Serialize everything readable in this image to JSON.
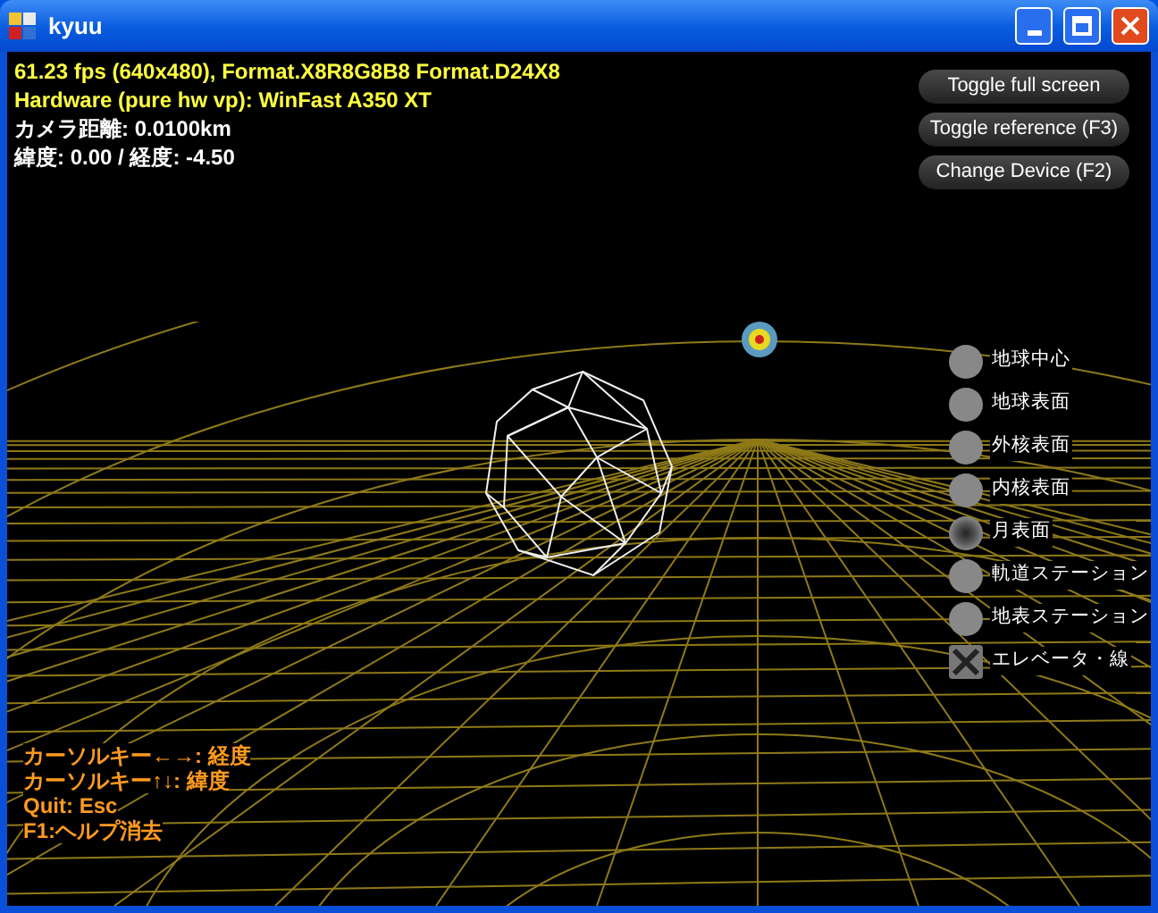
{
  "window": {
    "title": "kyuu"
  },
  "info_lines": [
    {
      "text": "61.23 fps (640x480), Format.X8R8G8B8 Format.D24X8",
      "kind": "stat"
    },
    {
      "text": "Hardware (pure hw vp): WinFast A350 XT",
      "kind": "stat"
    },
    {
      "text": "カメラ距離: 0.0100km",
      "kind": "value"
    },
    {
      "text": "緯度:  0.00 / 経度:  -4.50",
      "kind": "value"
    }
  ],
  "buttons": [
    "Toggle full screen",
    "Toggle reference (F3)",
    "Change Device (F2)"
  ],
  "options": [
    {
      "label": "地球中心",
      "kind": "radio",
      "selected": false
    },
    {
      "label": "地球表面",
      "kind": "radio",
      "selected": false
    },
    {
      "label": "外核表面",
      "kind": "radio",
      "selected": false
    },
    {
      "label": "内核表面",
      "kind": "radio",
      "selected": false
    },
    {
      "label": "月表面",
      "kind": "radio",
      "selected": true
    },
    {
      "label": "軌道ステーション",
      "kind": "radio",
      "selected": false
    },
    {
      "label": "地表ステーション",
      "kind": "radio",
      "selected": false
    },
    {
      "label": "エレベータ・線",
      "kind": "checkbox",
      "checked": true
    }
  ],
  "help_lines": [
    "カーソルキー←→: 経度",
    "カーソルキー↑↓: 緯度",
    "Quit: Esc",
    "F1:ヘルプ消去"
  ]
}
